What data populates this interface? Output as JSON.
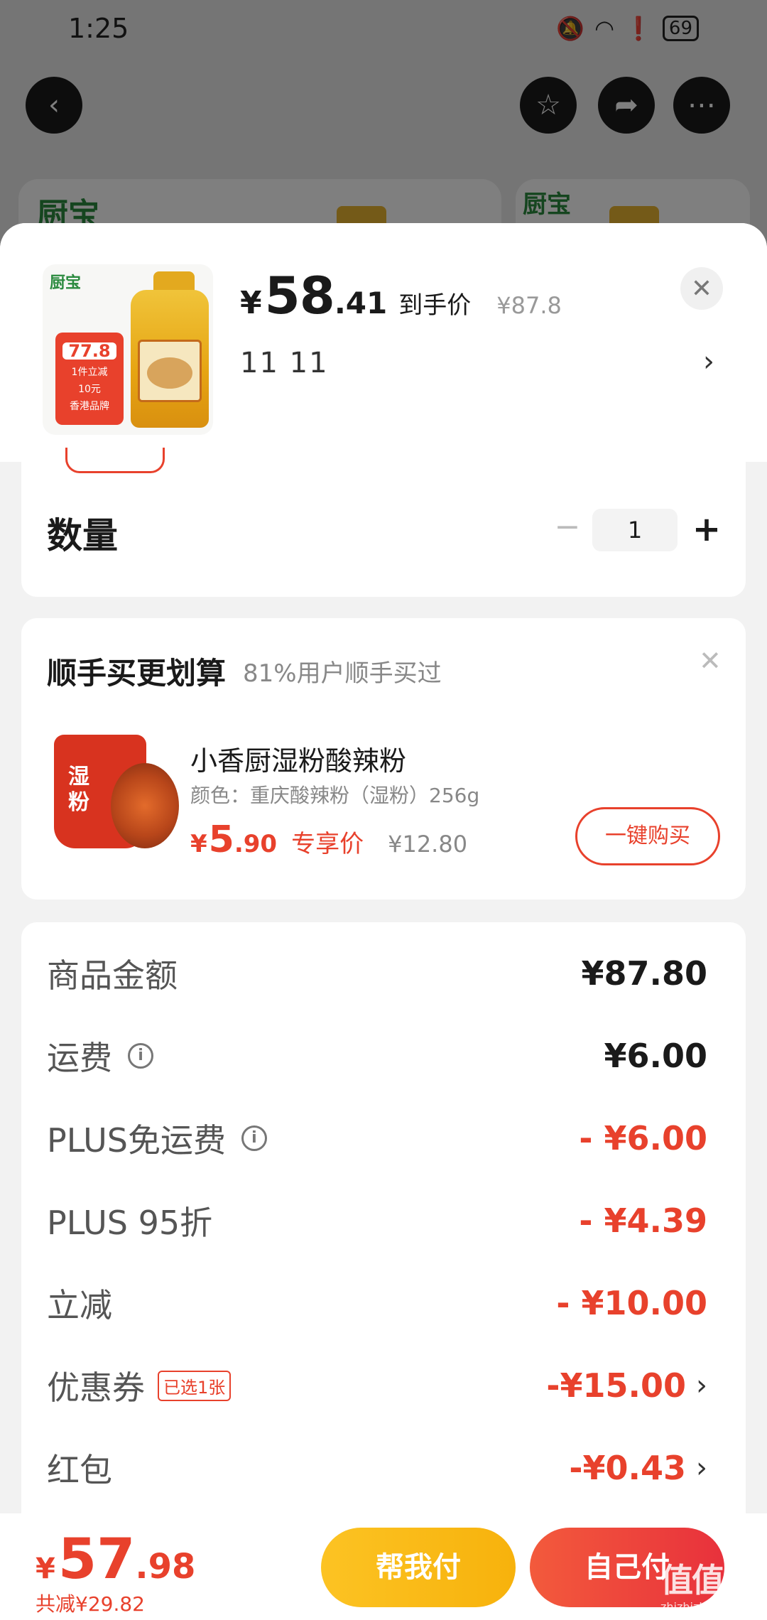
{
  "status": {
    "time": "1:25",
    "battery": "69"
  },
  "background": {
    "brand": "厨宝"
  },
  "product": {
    "thumb_logo": "厨宝",
    "badge_price": "77.8",
    "badge_line1": "1件立减",
    "badge_line2": "10元",
    "badge_line3": "香港品牌",
    "price_yen": "¥",
    "price_int": "58",
    "price_dec": ".41",
    "price_tag": "到手价",
    "original_price": "¥87.8",
    "spec": "11 11"
  },
  "quantity": {
    "label": "数量",
    "value": "1",
    "minus": "−",
    "plus": "+"
  },
  "recommend": {
    "title": "顺手买更划算",
    "subtitle": "81%用户顺手买过",
    "name": "小香厨湿粉酸辣粉",
    "spec": "颜色：重庆酸辣粉（湿粉）256g",
    "price_yen": "¥",
    "price_int": "5",
    "price_dec": ".90",
    "price_tag": "专享价",
    "original_price": "¥12.80",
    "buy_label": "一键购买"
  },
  "summary": {
    "rows": [
      {
        "label": "商品金额",
        "value": "¥87.80"
      },
      {
        "label": "运费",
        "value": "¥6.00"
      },
      {
        "label": "PLUS免运费",
        "value": "- ¥6.00"
      },
      {
        "label": "PLUS 95折",
        "value": "- ¥4.39"
      },
      {
        "label": "立减",
        "value": "- ¥10.00"
      },
      {
        "label": "优惠券",
        "tag": "已选1张",
        "value": "-¥15.00"
      },
      {
        "label": "红包",
        "value": "-¥0.43"
      }
    ]
  },
  "bottom": {
    "total_yen": "¥",
    "total_int": "57",
    "total_dec": ".98",
    "saved": "共减¥29.82",
    "help_pay": "帮我付",
    "self_pay": "自己付"
  },
  "watermark": {
    "main": "值值值",
    "sub": "zhizhizhi.com"
  },
  "colors": {
    "accent": "#e8412c",
    "help_button": "#f7b20c",
    "self_button": "#e8313c"
  }
}
